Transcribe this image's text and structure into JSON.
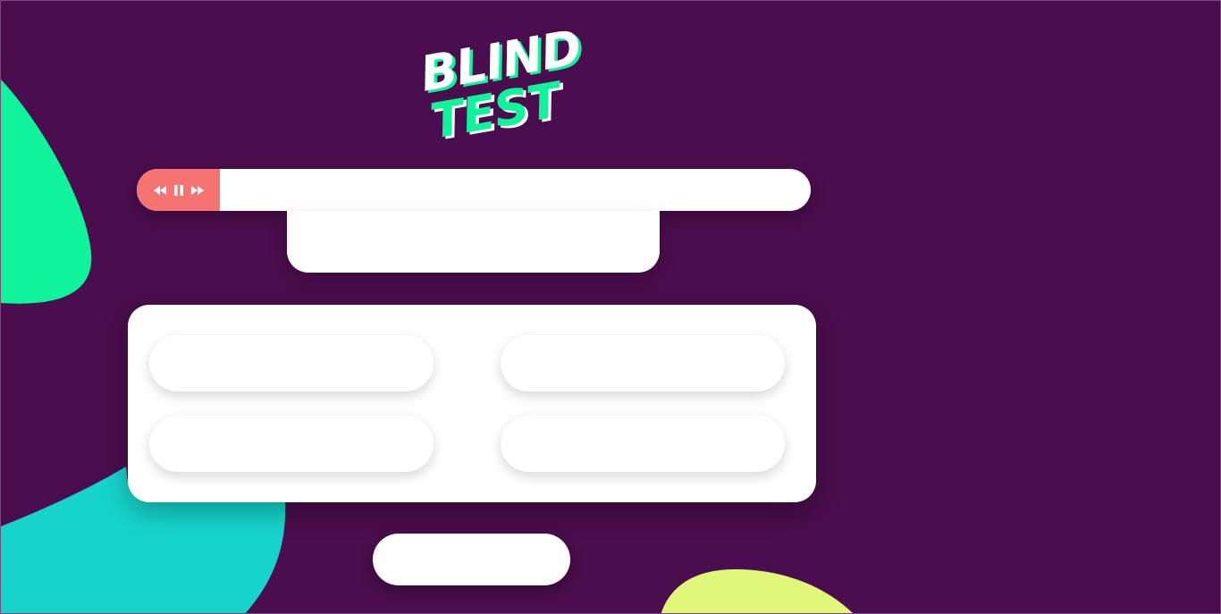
{
  "logo": {
    "line1": "BLIND",
    "line2": "TEST"
  },
  "player": {
    "controls": [
      "rewind-icon",
      "pause-icon",
      "fast-forward-icon"
    ],
    "track_text": ""
  },
  "cover_panel": {
    "text": ""
  },
  "answers": [
    {
      "label": ""
    },
    {
      "label": ""
    },
    {
      "label": ""
    },
    {
      "label": ""
    }
  ],
  "submit_button": {
    "label": ""
  },
  "colors": {
    "background": "#4a0d4d",
    "green_accent": "#10f39a",
    "teal_accent": "#16d4cc",
    "lime_accent": "#e0f77a",
    "controls_coral": "#f57370",
    "surface": "#ffffff"
  }
}
